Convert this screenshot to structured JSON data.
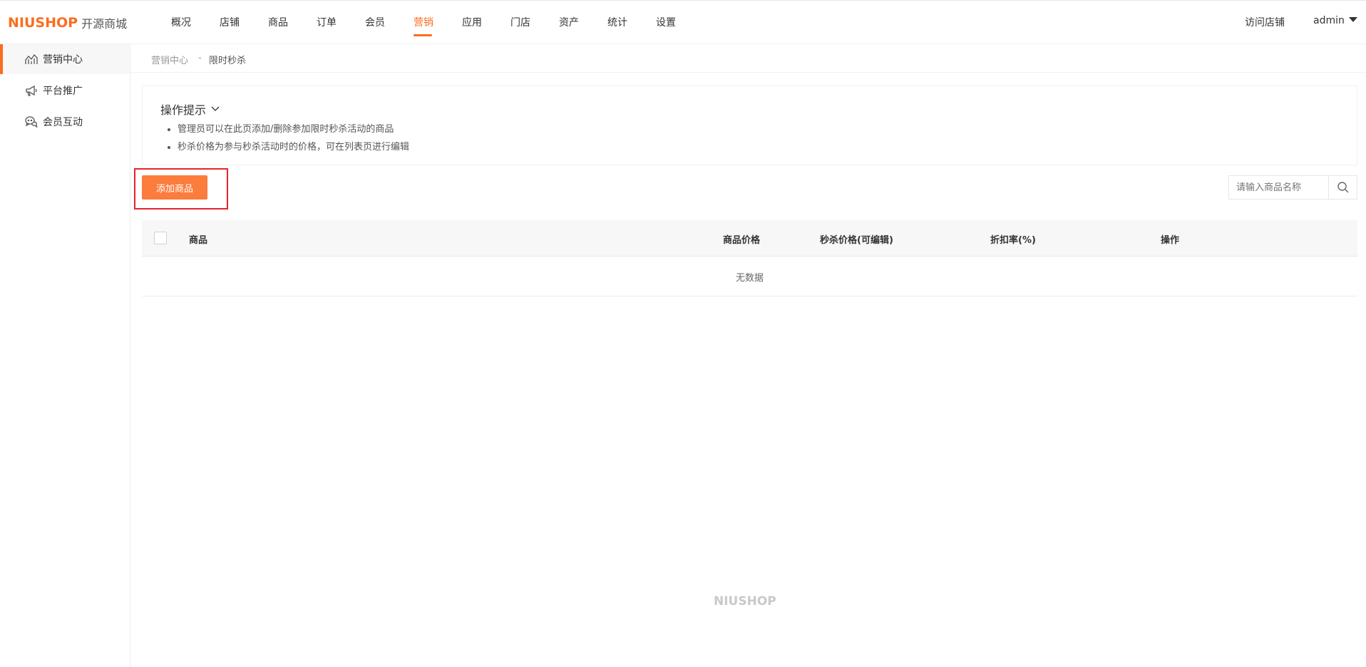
{
  "brand": {
    "logo_text": "NIUSHOP",
    "logo_sub": "开源商城",
    "accent_color": "#fb6d1e",
    "footer_logo": "NIUSHOP"
  },
  "nav": {
    "items": [
      {
        "label": "概况"
      },
      {
        "label": "店铺"
      },
      {
        "label": "商品"
      },
      {
        "label": "订单"
      },
      {
        "label": "会员"
      },
      {
        "label": "营销"
      },
      {
        "label": "应用"
      },
      {
        "label": "门店"
      },
      {
        "label": "资产"
      },
      {
        "label": "统计"
      },
      {
        "label": "设置"
      }
    ],
    "active": "营销",
    "visit_store": "访问店铺",
    "user": "admin"
  },
  "sidebar": {
    "items": [
      {
        "label": "营销中心",
        "icon": "chart-icon"
      },
      {
        "label": "平台推广",
        "icon": "megaphone-icon"
      },
      {
        "label": "会员互动",
        "icon": "chat-icon"
      }
    ],
    "active": "营销中心"
  },
  "breadcrumb": {
    "parent": "营销中心",
    "separator": "-",
    "current": "限时秒杀"
  },
  "tips": {
    "title": "操作提示",
    "items": [
      "管理员可以在此页添加/删除参加限时秒杀活动的商品",
      "秒杀价格为参与秒杀活动时的价格，可在列表页进行编辑"
    ]
  },
  "toolbar": {
    "add_label": "添加商品",
    "search_placeholder": "请输入商品名称"
  },
  "table": {
    "columns": [
      "商品",
      "商品价格",
      "秒杀价格(可编辑)",
      "折扣率(%)",
      "操作"
    ],
    "empty_text": "无数据"
  }
}
